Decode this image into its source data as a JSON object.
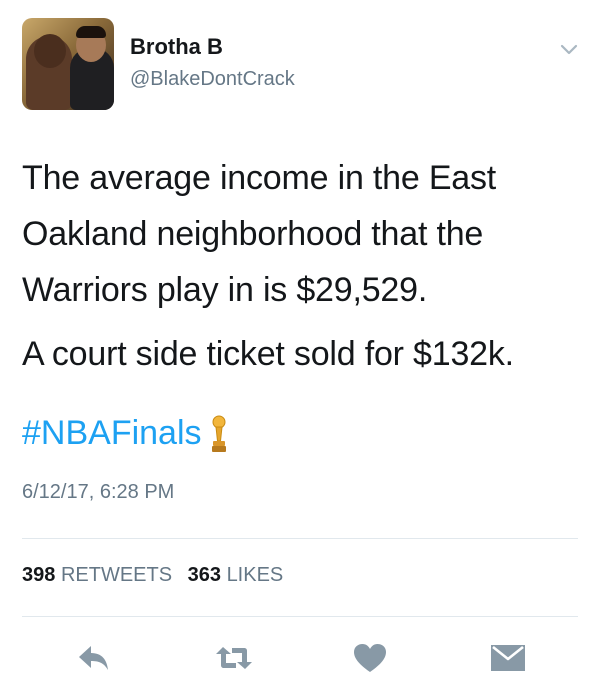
{
  "user": {
    "name": "Brotha B",
    "handle": "@BlakeDontCrack"
  },
  "tweet": {
    "lines": [
      "The average income in the East",
      "Oakland neighborhood that the",
      "Warriors play in is $29,529."
    ],
    "line2": "A court side ticket sold for $132k.",
    "hashtag": "#NBAFinals",
    "emoji": "trophy-icon",
    "timestamp": "6/12/17, 6:28 PM"
  },
  "stats": {
    "retweets_count": "398",
    "retweets_label": "RETWEETS",
    "likes_count": "363",
    "likes_label": "LIKES"
  },
  "colors": {
    "link": "#1da1f2",
    "secondary": "#657786",
    "icon": "#657786",
    "divider": "#e1e8ed"
  }
}
